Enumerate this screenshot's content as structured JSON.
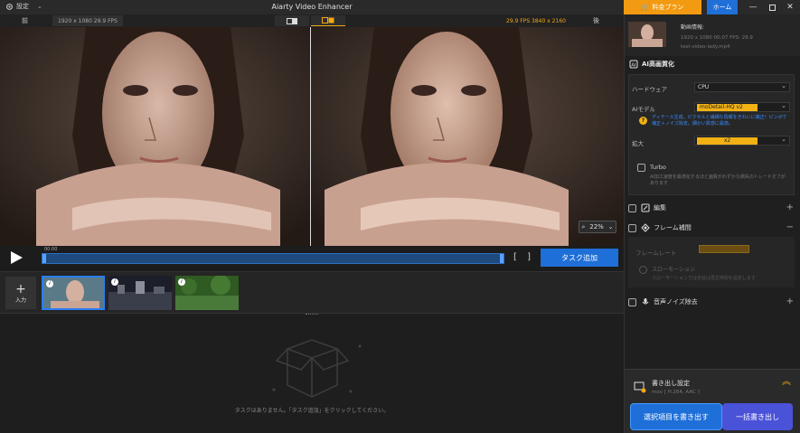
{
  "titlebar": {
    "settings_label": "設定",
    "app_title": "Aiarty Video Enhancer",
    "plan_label": "料金プラン",
    "home_label": "ホーム"
  },
  "preview": {
    "before_label": "前",
    "after_label": "後",
    "before_info": "1920 x 1080   29.9 FPS",
    "after_info": "29.9 FPS   3840 x 2160",
    "zoom_level": "22%"
  },
  "timeline": {
    "current_time": "00:00",
    "add_task_label": "タスク追加"
  },
  "clips": {
    "input_label": "入力"
  },
  "tasks": {
    "empty_message": "タスクはありません。「タスク追加」をクリックしてください。"
  },
  "file_info": {
    "title": "動画情報:",
    "meta": "1920 x 1080   00:07   FPS: 29.9",
    "filename": "test-video-lady.mp4"
  },
  "ai_section": {
    "title": "AI高画質化",
    "hardware_label": "ハードウェア",
    "hardware_value": "CPU",
    "model_label": "AIモデル",
    "model_value": "moDetail-HQ  v2",
    "model_note": "ディテール生成。ピクセルと繊細な情報をきれいに補正！ピンボケ補正＋ノイズ除去。細かい質感に最適。",
    "upscale_label": "拡大",
    "upscale_value": "x2",
    "turbo_label": "Turbo",
    "turbo_desc": "AI加工速度を最適化するほど画質がわずかな損失のトレードオフがあります"
  },
  "sections": {
    "edit_label": "編集",
    "frame_label": "フレーム補間",
    "framerate_label": "フレームレート",
    "slowmo_label": "スローモーション",
    "slowmo_desc": "スローモーションでは全延ば再生時間を設定します",
    "noise_label": "音声ノイズ除去"
  },
  "export": {
    "title": "書き出し設定",
    "format": "mov [ H.264, AAC ]",
    "export_selected": "選択項目を書き出す",
    "export_all": "一括書き出し"
  },
  "colors": {
    "accent_orange": "#f29a11",
    "accent_blue": "#1f6fd8",
    "highlight_yellow": "#f2b214"
  }
}
